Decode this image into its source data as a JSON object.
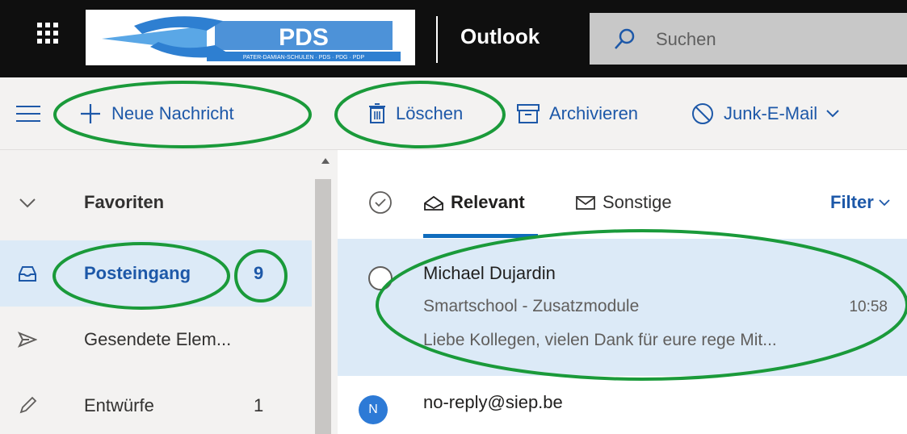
{
  "app": {
    "title": "Outlook",
    "logo_text": "PDS",
    "logo_subtext": "PATER-DAMIAN-SCHULEN · PDS · PDG · PDP"
  },
  "search": {
    "placeholder": "Suchen"
  },
  "toolbar": {
    "new_message": "Neue Nachricht",
    "delete": "Löschen",
    "archive": "Archivieren",
    "junk": "Junk-E-Mail"
  },
  "sidebar": {
    "items": [
      {
        "label": "Favoriten",
        "count": "",
        "icon": "chevron-down-icon"
      },
      {
        "label": "Posteingang",
        "count": "9",
        "icon": "inbox-icon"
      },
      {
        "label": "Gesendete Elem...",
        "count": "",
        "icon": "send-icon"
      },
      {
        "label": "Entwürfe",
        "count": "1",
        "icon": "pencil-icon"
      }
    ]
  },
  "maillist": {
    "tabs": [
      {
        "label": "Relevant"
      },
      {
        "label": "Sonstige"
      }
    ],
    "filter_label": "Filter",
    "messages": [
      {
        "sender": "Michael Dujardin",
        "subject": "Smartschool - Zusatzmodule",
        "time": "10:58",
        "preview": "Liebe Kollegen, vielen Dank für eure rege Mit..."
      },
      {
        "sender": "no-reply@siep.be",
        "avatar_letter": "N"
      }
    ]
  },
  "colors": {
    "accent": "#1d58a8",
    "topbar": "#0f0f0f",
    "selected": "#dceaf7",
    "annotation": "#1a9a3a"
  }
}
